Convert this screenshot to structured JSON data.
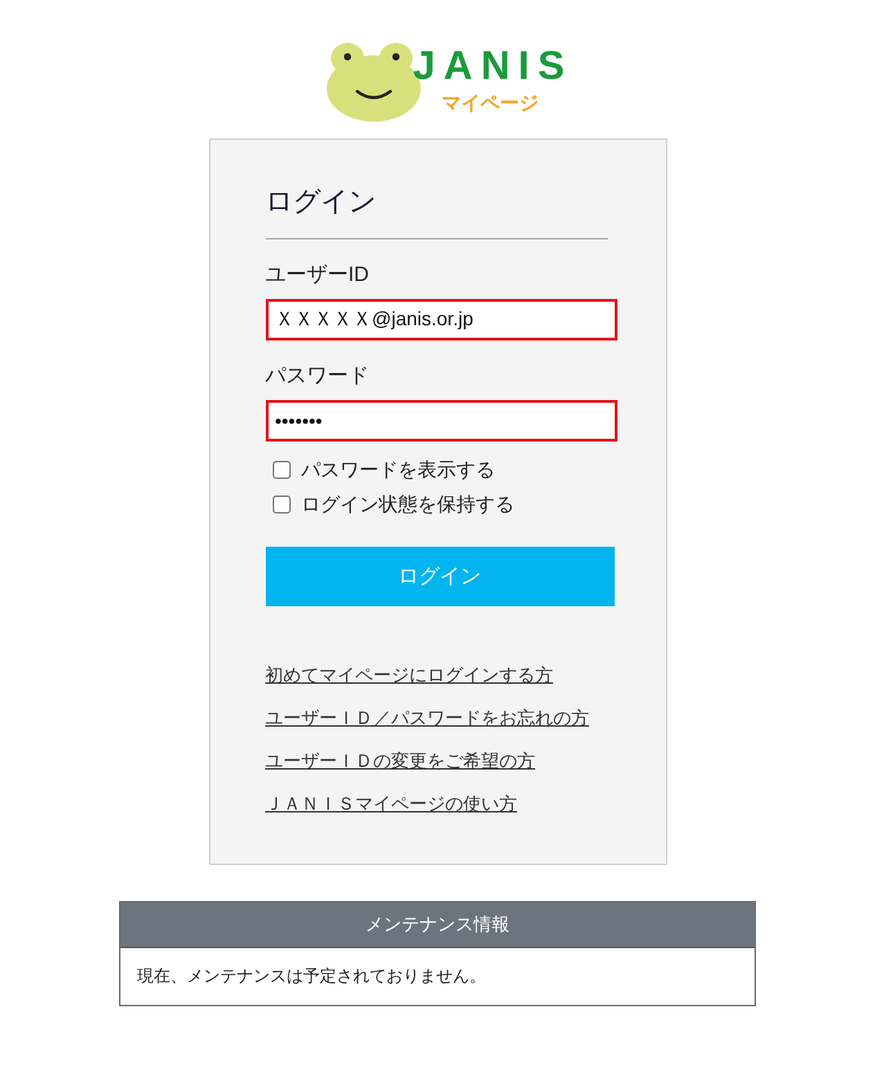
{
  "logo": {
    "wordmark": "JANIS",
    "subtitle": "マイページ"
  },
  "login": {
    "title": "ログイン",
    "fields": [
      {
        "label": "ユーザーID",
        "value": "ＸＸＸＸＸ@janis.or.jp",
        "error": true
      },
      {
        "label": "パスワード",
        "value": "•••••••",
        "error": true
      }
    ],
    "options": [
      {
        "label": "パスワードを表示する",
        "checked": false
      },
      {
        "label": "ログイン状態を保持する",
        "checked": false
      }
    ],
    "submit": "ログイン",
    "links": [
      "初めてマイページにログインする方",
      "ユーザーＩＤ／パスワードをお忘れの方",
      "ユーザーＩＤの変更をご希望の方",
      "ＪＡＮＩＳマイページの使い方"
    ]
  },
  "maintenance": {
    "title": "メンテナンス情報",
    "message": "現在、メンテナンスは予定されておりません。"
  }
}
